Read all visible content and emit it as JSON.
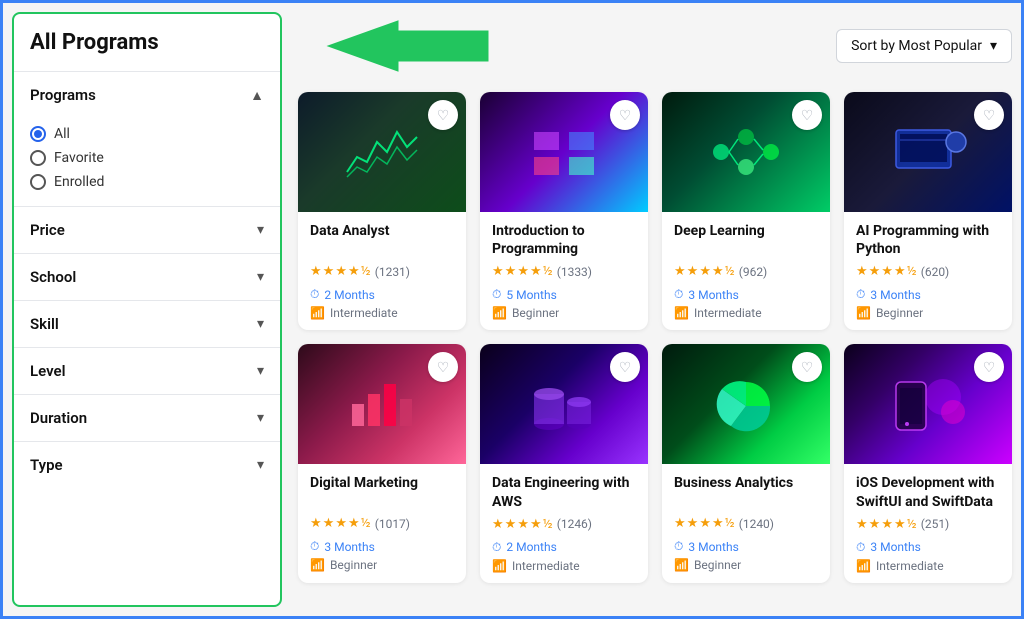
{
  "sidebar": {
    "title": "All Programs",
    "filters": [
      {
        "label": "Programs",
        "expanded": true,
        "chevron": "▲",
        "options": [
          {
            "label": "All",
            "selected": true
          },
          {
            "label": "Favorite",
            "selected": false
          },
          {
            "label": "Enrolled",
            "selected": false
          }
        ]
      },
      {
        "label": "Price",
        "expanded": false,
        "chevron": "▾"
      },
      {
        "label": "School",
        "expanded": false,
        "chevron": "▾"
      },
      {
        "label": "Skill",
        "expanded": false,
        "chevron": "▾"
      },
      {
        "label": "Level",
        "expanded": false,
        "chevron": "▾"
      },
      {
        "label": "Duration",
        "expanded": false,
        "chevron": "▾"
      },
      {
        "label": "Type",
        "expanded": false,
        "chevron": "▾"
      }
    ]
  },
  "header": {
    "sort_label": "Sort by Most Popular",
    "sort_chevron": "▾"
  },
  "cards": [
    {
      "id": 1,
      "title": "Data Analyst",
      "rating_value": "4.5",
      "rating_count": "(1231)",
      "duration": "2 Months",
      "level": "Intermediate",
      "img_class": "card-img-1"
    },
    {
      "id": 2,
      "title": "Introduction to Programming",
      "rating_value": "4.5",
      "rating_count": "(1333)",
      "duration": "5 Months",
      "level": "Beginner",
      "img_class": "card-img-2"
    },
    {
      "id": 3,
      "title": "Deep Learning",
      "rating_value": "4.5",
      "rating_count": "(962)",
      "duration": "3 Months",
      "level": "Intermediate",
      "img_class": "card-img-3"
    },
    {
      "id": 4,
      "title": "AI Programming with Python",
      "rating_value": "4.5",
      "rating_count": "(620)",
      "duration": "3 Months",
      "level": "Beginner",
      "img_class": "card-img-4"
    },
    {
      "id": 5,
      "title": "Digital Marketing",
      "rating_value": "4.5",
      "rating_count": "(1017)",
      "duration": "3 Months",
      "level": "Beginner",
      "img_class": "card-img-5"
    },
    {
      "id": 6,
      "title": "Data Engineering with AWS",
      "rating_value": "4.5",
      "rating_count": "(1246)",
      "duration": "2 Months",
      "level": "Intermediate",
      "img_class": "card-img-6"
    },
    {
      "id": 7,
      "title": "Business Analytics",
      "rating_value": "4.5",
      "rating_count": "(1240)",
      "duration": "3 Months",
      "level": "Beginner",
      "img_class": "card-img-7"
    },
    {
      "id": 8,
      "title": "iOS Development with SwiftUI and SwiftData",
      "rating_value": "4.5",
      "rating_count": "(251)",
      "duration": "3 Months",
      "level": "Intermediate",
      "img_class": "card-img-8"
    }
  ]
}
